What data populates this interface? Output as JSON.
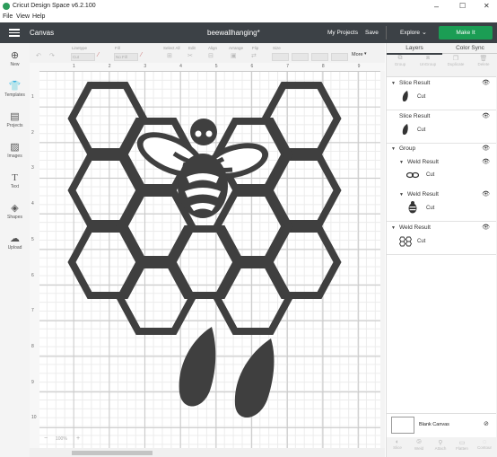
{
  "window": {
    "title": "Cricut Design Space  v6.2.100",
    "controls": {
      "minimize": "–",
      "maximize": "☐",
      "close": "✕"
    }
  },
  "menu": [
    "File",
    "View",
    "Help"
  ],
  "header": {
    "section": "Canvas",
    "project_name": "beewallhanging*",
    "my_projects": "My Projects",
    "save": "Save",
    "explore": "Explore",
    "make_it": "Make It",
    "accent_color": "#1b9d54",
    "bar_color": "#3c4146"
  },
  "toolbar": {
    "linetype": "Linetype",
    "linetype_value": "Cut",
    "fill": "Fill",
    "fill_value": "No Fill",
    "select_all": "Select All",
    "edit": "Edit",
    "align": "Align",
    "arrange": "Arrange",
    "flip": "Flip",
    "size": "Size",
    "more": "More"
  },
  "sidebar": [
    {
      "icon": "plus-icon",
      "label": "New"
    },
    {
      "icon": "shirt-icon",
      "label": "Templates"
    },
    {
      "icon": "projects-icon",
      "label": "Projects"
    },
    {
      "icon": "image-icon",
      "label": "Images"
    },
    {
      "icon": "text-icon",
      "label": "Text"
    },
    {
      "icon": "shapes-icon",
      "label": "Shapes"
    },
    {
      "icon": "upload-icon",
      "label": "Upload"
    }
  ],
  "ruler": {
    "horizontal": [
      "1",
      "2",
      "3",
      "4",
      "5",
      "6",
      "7",
      "8",
      "9"
    ],
    "vertical": [
      "1",
      "2",
      "3",
      "4",
      "5",
      "6",
      "7",
      "8",
      "9",
      "10",
      "11"
    ]
  },
  "zoom": {
    "minus": "−",
    "value": "100%",
    "plus": "+"
  },
  "panel": {
    "tabs": [
      "Layers",
      "Color Sync"
    ],
    "actions": [
      "Group",
      "UnGroup",
      "Duplicate",
      "Delete"
    ],
    "layers": [
      {
        "title": "Slice Result",
        "item": "Cut",
        "thumb": "petal"
      },
      {
        "title": "Slice Result",
        "item": "Cut",
        "thumb": "petal"
      },
      {
        "title": "Group"
      },
      {
        "title": "Weld Result",
        "item": "Cut",
        "thumb": "bee-wings"
      },
      {
        "title": "Weld Result",
        "item": "Cut",
        "thumb": "bee-body"
      },
      {
        "title": "Weld Result",
        "item": "Cut",
        "thumb": "honeycomb"
      }
    ],
    "blank_canvas": "Blank Canvas",
    "bottom_actions": [
      "Slice",
      "Weld",
      "Attach",
      "Flatten",
      "Contour"
    ]
  }
}
